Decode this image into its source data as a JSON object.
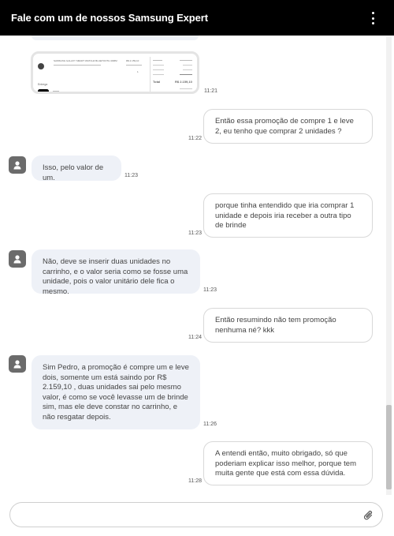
{
  "header": {
    "title": "Fale com um de nossos Samsung Expert",
    "menu_icon": "more-vertical-icon"
  },
  "image_message": {
    "time": "11:21",
    "thumb_texts": {
      "product": "SAMSUNG GALAXY SMART WATCH4 BLUETOOTH 40MM",
      "price1": "R$ 2.159,10",
      "qty": "1",
      "label_entrega": "Entrega",
      "total_label": "Total",
      "total_value": "R$ 2.159,10"
    }
  },
  "messages": [
    {
      "from": "user",
      "text": "Então essa promoção de compre 1 e leve 2, eu tenho que comprar 2 unidades ?",
      "time": "11:22"
    },
    {
      "from": "agent",
      "text": "Isso, pelo valor de um.",
      "time": "11:23"
    },
    {
      "from": "user",
      "text": "porque tinha entendido que iria comprar 1 unidade e depois iria receber a outra tipo de brinde",
      "time": "11:23"
    },
    {
      "from": "agent",
      "text": "Não, deve se inserir duas unidades no carrinho, e o valor seria como se fosse uma unidade, pois o valor unitário dele fica o mesmo.",
      "time": "11:23"
    },
    {
      "from": "user",
      "text": "Então resumindo não tem promoção nenhuma né? kkk",
      "time": "11:24"
    },
    {
      "from": "agent",
      "text": "Sim Pedro, a promoção é compre um e leve dois, somente um está saindo por R$ 2.159,10 , duas unidades sai pelo mesmo valor, é como se você levasse um de brinde sim, mas ele deve constar no carrinho, e não resgatar depois.",
      "time": "11:26"
    },
    {
      "from": "user",
      "text": "A entendi então,  muito obrigado, só que poderiam explicar isso melhor, porque tem muita gente que está com essa dúvida.",
      "time": "11:28"
    }
  ],
  "composer": {
    "placeholder": "",
    "attach_icon": "paperclip-icon"
  }
}
